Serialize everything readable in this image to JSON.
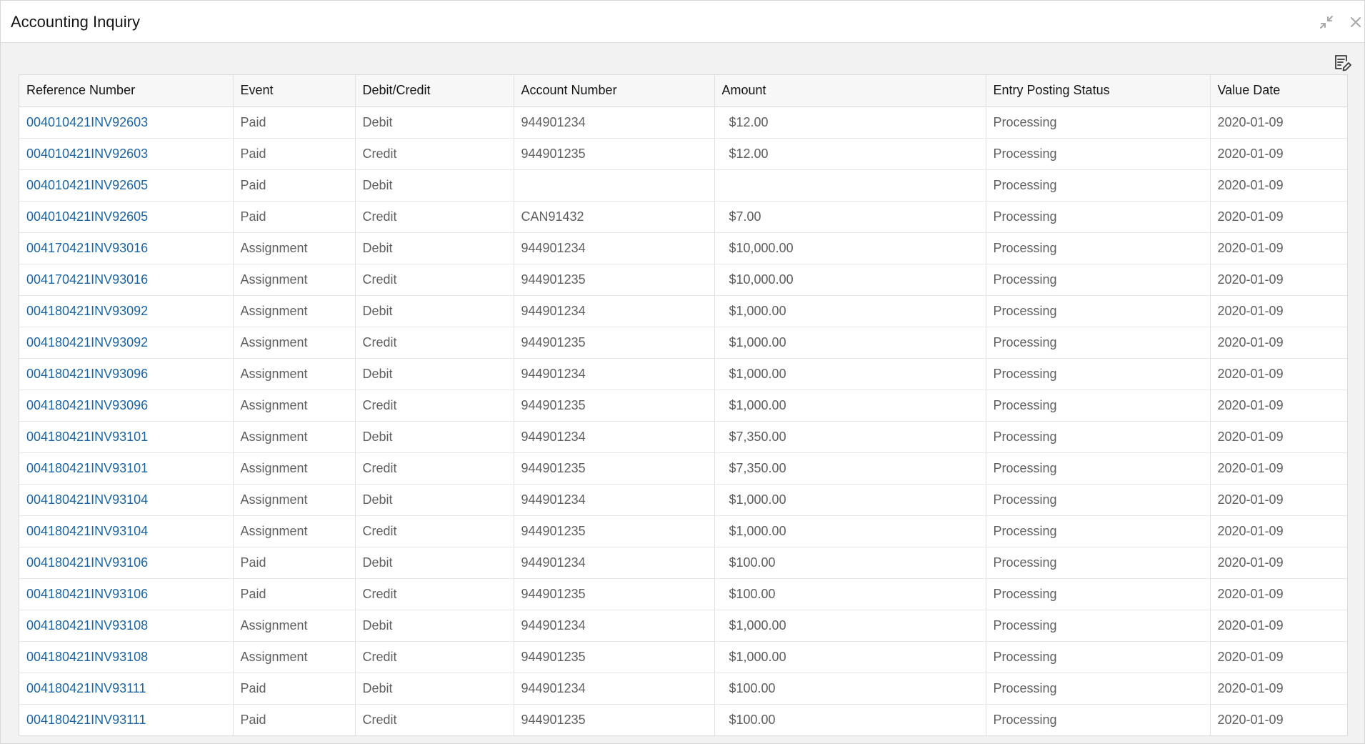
{
  "window": {
    "title": "Accounting Inquiry",
    "restore_icon": "restore-icon",
    "close_icon": "close-icon"
  },
  "toolbar": {
    "edit_icon": "edit-list-icon"
  },
  "table": {
    "columns": [
      "Reference Number",
      "Event",
      "Debit/Credit",
      "Account Number",
      "Amount",
      "Entry Posting Status",
      "Value Date"
    ],
    "rows": [
      [
        "004010421INV92603",
        "Paid",
        "Debit",
        "944901234",
        "$12.00",
        "Processing",
        "2020-01-09"
      ],
      [
        "004010421INV92603",
        "Paid",
        "Credit",
        "944901235",
        "$12.00",
        "Processing",
        "2020-01-09"
      ],
      [
        "004010421INV92605",
        "Paid",
        "Debit",
        "",
        "",
        "Processing",
        "2020-01-09"
      ],
      [
        "004010421INV92605",
        "Paid",
        "Credit",
        "CAN91432",
        "$7.00",
        "Processing",
        "2020-01-09"
      ],
      [
        "004170421INV93016",
        "Assignment",
        "Debit",
        "944901234",
        "$10,000.00",
        "Processing",
        "2020-01-09"
      ],
      [
        "004170421INV93016",
        "Assignment",
        "Credit",
        "944901235",
        "$10,000.00",
        "Processing",
        "2020-01-09"
      ],
      [
        "004180421INV93092",
        "Assignment",
        "Debit",
        "944901234",
        "$1,000.00",
        "Processing",
        "2020-01-09"
      ],
      [
        "004180421INV93092",
        "Assignment",
        "Credit",
        "944901235",
        "$1,000.00",
        "Processing",
        "2020-01-09"
      ],
      [
        "004180421INV93096",
        "Assignment",
        "Debit",
        "944901234",
        "$1,000.00",
        "Processing",
        "2020-01-09"
      ],
      [
        "004180421INV93096",
        "Assignment",
        "Credit",
        "944901235",
        "$1,000.00",
        "Processing",
        "2020-01-09"
      ],
      [
        "004180421INV93101",
        "Assignment",
        "Debit",
        "944901234",
        "$7,350.00",
        "Processing",
        "2020-01-09"
      ],
      [
        "004180421INV93101",
        "Assignment",
        "Credit",
        "944901235",
        "$7,350.00",
        "Processing",
        "2020-01-09"
      ],
      [
        "004180421INV93104",
        "Assignment",
        "Debit",
        "944901234",
        "$1,000.00",
        "Processing",
        "2020-01-09"
      ],
      [
        "004180421INV93104",
        "Assignment",
        "Credit",
        "944901235",
        "$1,000.00",
        "Processing",
        "2020-01-09"
      ],
      [
        "004180421INV93106",
        "Paid",
        "Debit",
        "944901234",
        "$100.00",
        "Processing",
        "2020-01-09"
      ],
      [
        "004180421INV93106",
        "Paid",
        "Credit",
        "944901235",
        "$100.00",
        "Processing",
        "2020-01-09"
      ],
      [
        "004180421INV93108",
        "Assignment",
        "Debit",
        "944901234",
        "$1,000.00",
        "Processing",
        "2020-01-09"
      ],
      [
        "004180421INV93108",
        "Assignment",
        "Credit",
        "944901235",
        "$1,000.00",
        "Processing",
        "2020-01-09"
      ],
      [
        "004180421INV93111",
        "Paid",
        "Debit",
        "944901234",
        "$100.00",
        "Processing",
        "2020-01-09"
      ],
      [
        "004180421INV93111",
        "Paid",
        "Credit",
        "944901235",
        "$100.00",
        "Processing",
        "2020-01-09"
      ]
    ]
  },
  "colors": {
    "link": "#1b65a6",
    "header_bg": "#f7f7f7",
    "panel_bg": "#f2f2f2",
    "text_muted": "#5f5f5f"
  }
}
